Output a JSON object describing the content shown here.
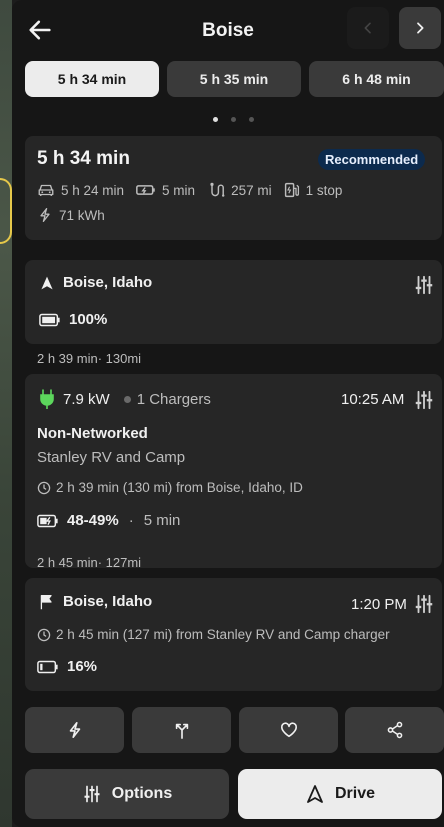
{
  "header": {
    "title": "Boise",
    "back_icon": "back-arrow-icon"
  },
  "tabs": [
    {
      "label": "5 h 34 min",
      "active": true
    },
    {
      "label": "5 h 35 min",
      "active": false
    },
    {
      "label": "6 h 48 min",
      "active": false
    }
  ],
  "pager": {
    "count": 3,
    "active": 0
  },
  "summary": {
    "time": "5 h 34 min",
    "badge": "Recommended",
    "drive_time": "5 h 24 min",
    "charge_time": "5 min",
    "distance": "257 mi",
    "stops": "1 stop",
    "energy": "71 kWh"
  },
  "origin": {
    "name": "Boise, Idaho",
    "battery": "100%"
  },
  "leg1": "2 h 39 min· 130mi",
  "charger": {
    "power": "7.9 kW",
    "chargers": "1 Chargers",
    "time": "10:25 AM",
    "network": "Non-Networked",
    "name": "Stanley RV and Camp",
    "from": "2 h 39 min (130 mi) from Boise, Idaho, ID",
    "charge_range": "48-49%",
    "sep": "·",
    "charge_duration": "5 min"
  },
  "leg2": "2 h 45 min· 127mi",
  "destination": {
    "name": "Boise, Idaho",
    "time": "1:20 PM",
    "from": "2 h 45 min (127 mi) from Stanley RV and Camp charger",
    "battery": "16%"
  },
  "actions": [
    "bolt-icon",
    "fork-icon",
    "heart-icon",
    "share-icon"
  ],
  "buttons": {
    "options": "Options",
    "drive": "Drive"
  },
  "colors": {
    "badge_bg": "#0c2a4d",
    "charger_green": "#5cd65c",
    "panel": "#161616",
    "card": "#262626"
  }
}
